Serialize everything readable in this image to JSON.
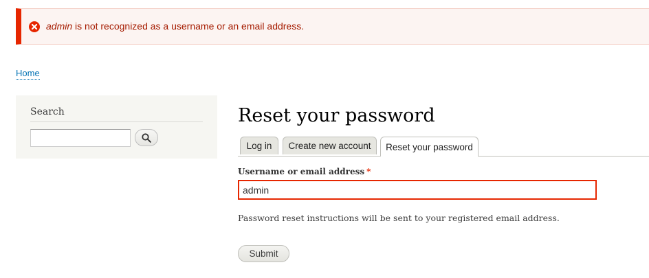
{
  "error_message": {
    "username": "admin",
    "text": " is not recognized as a username or an email address.",
    "icon": "error-icon",
    "color": "#e62600"
  },
  "breadcrumb": {
    "home": "Home"
  },
  "sidebar": {
    "search_title": "Search",
    "search_value": "",
    "search_icon": "search-icon"
  },
  "main": {
    "title": "Reset your password",
    "tabs": [
      {
        "label": "Log in",
        "active": false
      },
      {
        "label": "Create new account",
        "active": false
      },
      {
        "label": "Reset your password",
        "active": true
      }
    ],
    "field_label": "Username or email address",
    "required_marker": "*",
    "field_value": "admin",
    "description": "Password reset instructions will be sent to your registered email address.",
    "submit_label": "Submit"
  }
}
